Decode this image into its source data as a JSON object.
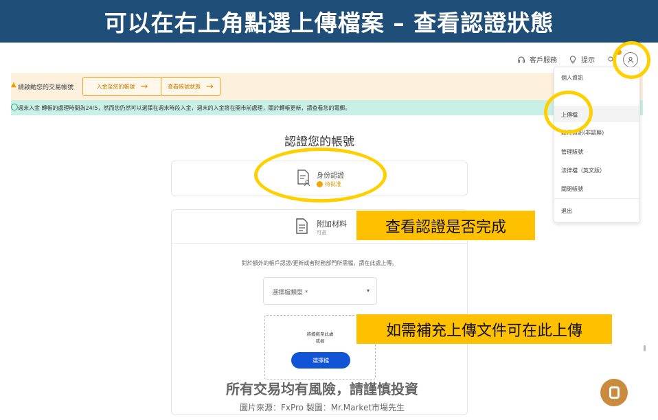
{
  "banner": {
    "title": "可以在右上角點選上傳檔案 – 查看認證狀態"
  },
  "topnav": {
    "support_label": "客戶服務",
    "tips_label": "提示"
  },
  "warn_bar": {
    "text": "請啟動您的交易帳號",
    "fund_button": "入金至您的帳號",
    "status_button": "查看帳號狀態"
  },
  "info_bar": {
    "text": "週末入金 轉帳的處理時間為24/5，然而您仍然可以選擇在週末時段入金，週末的入金將在開市前處理，關於轉帳更新，請查看您的電郵。"
  },
  "main": {
    "title": "認證您的帳號",
    "identity_card": {
      "label": "身份認證",
      "status": "待批准"
    },
    "extra_card": {
      "label": "附加材料",
      "sub": "可選",
      "description": "對於額外的帳戶認證/更新或者財務部門所需檔，請在此處上傳。",
      "select_placeholder": "選擇檔類型 *",
      "drop_text_line1": "將檔拖至此處",
      "drop_text_line2": "或者",
      "choose_button": "選擇檔"
    }
  },
  "dropdown": {
    "items": [
      "個人資訊",
      "上傳檔",
      "銀行資訊(非認聯)",
      "管理賬號",
      "法律檔（英文版）",
      "關閉帳號",
      "退出"
    ]
  },
  "callouts": {
    "status": "查看認證是否完成",
    "upload": "如需補充上傳文件可在此上傳"
  },
  "footer": {
    "risk": "所有交易均有風險，請謹慎投資",
    "source": "圖片來源：FxPro 製圖：Mr.Market市場先生"
  },
  "colors": {
    "banner": "#1f4e79",
    "highlight_ring": "#ffd000",
    "callout": "#ffc000",
    "primary_button": "#1155d6",
    "warn_bg": "#fdf0dc",
    "info_bg": "#c9f0e6"
  },
  "icons": [
    "headset-icon",
    "lightbulb-icon",
    "gear-icon",
    "user-icon",
    "document-user-icon",
    "document-icon",
    "chat-icon"
  ]
}
